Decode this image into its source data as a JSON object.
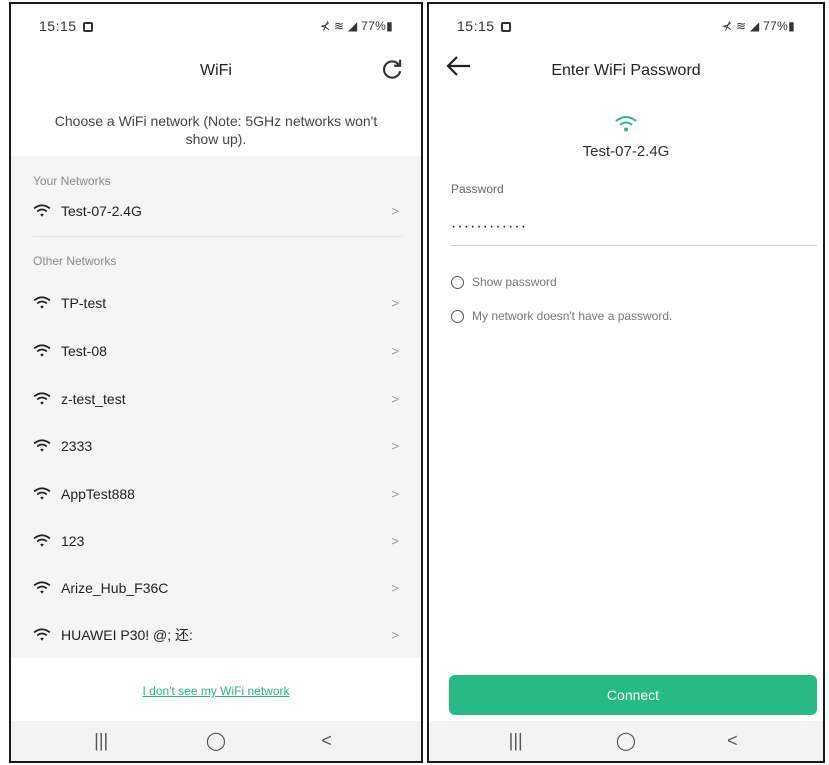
{
  "status_bar": {
    "time": "15:15",
    "right": "⊀ ≋ ◢ 77%▮"
  },
  "wifi_list_screen": {
    "title": "WiFi",
    "refresh_icon": "refresh-icon",
    "hint": "Choose a WiFi network (Note: 5GHz networks won't show up).",
    "your_networks_label": "Your Networks",
    "your_networks": [
      {
        "name": "Test-07-2.4G",
        "chevron": ">"
      }
    ],
    "other_networks_label": "Other Networks",
    "other_networks": [
      {
        "name": "TP-test",
        "chevron": ">"
      },
      {
        "name": "Test-08",
        "chevron": ">"
      },
      {
        "name": "z-test_test",
        "chevron": ">"
      },
      {
        "name": "2333",
        "chevron": ">"
      },
      {
        "name": "AppTest888",
        "chevron": ">"
      },
      {
        "name": "123",
        "chevron": ">"
      },
      {
        "name": "Arize_Hub_F36C",
        "chevron": ">"
      },
      {
        "name": "HUAWEI P30! @; 还:",
        "chevron": ">"
      }
    ],
    "no_network_link": "I don't see my WiFi network"
  },
  "password_screen": {
    "back_icon": "back-arrow-icon",
    "title": "Enter WiFi Password",
    "ssid": "Test-07-2.4G",
    "password_label": "Password",
    "password_value": "············",
    "options": [
      {
        "label": "Show password"
      },
      {
        "label": "My network doesn't have a password."
      }
    ],
    "connect_label": "Connect"
  },
  "system_nav": {
    "recents": "|||",
    "home": "◯",
    "back": "<"
  },
  "colors": {
    "accent": "#27ba86",
    "link": "#2bb47d",
    "list_background": "#f5f5f5"
  }
}
